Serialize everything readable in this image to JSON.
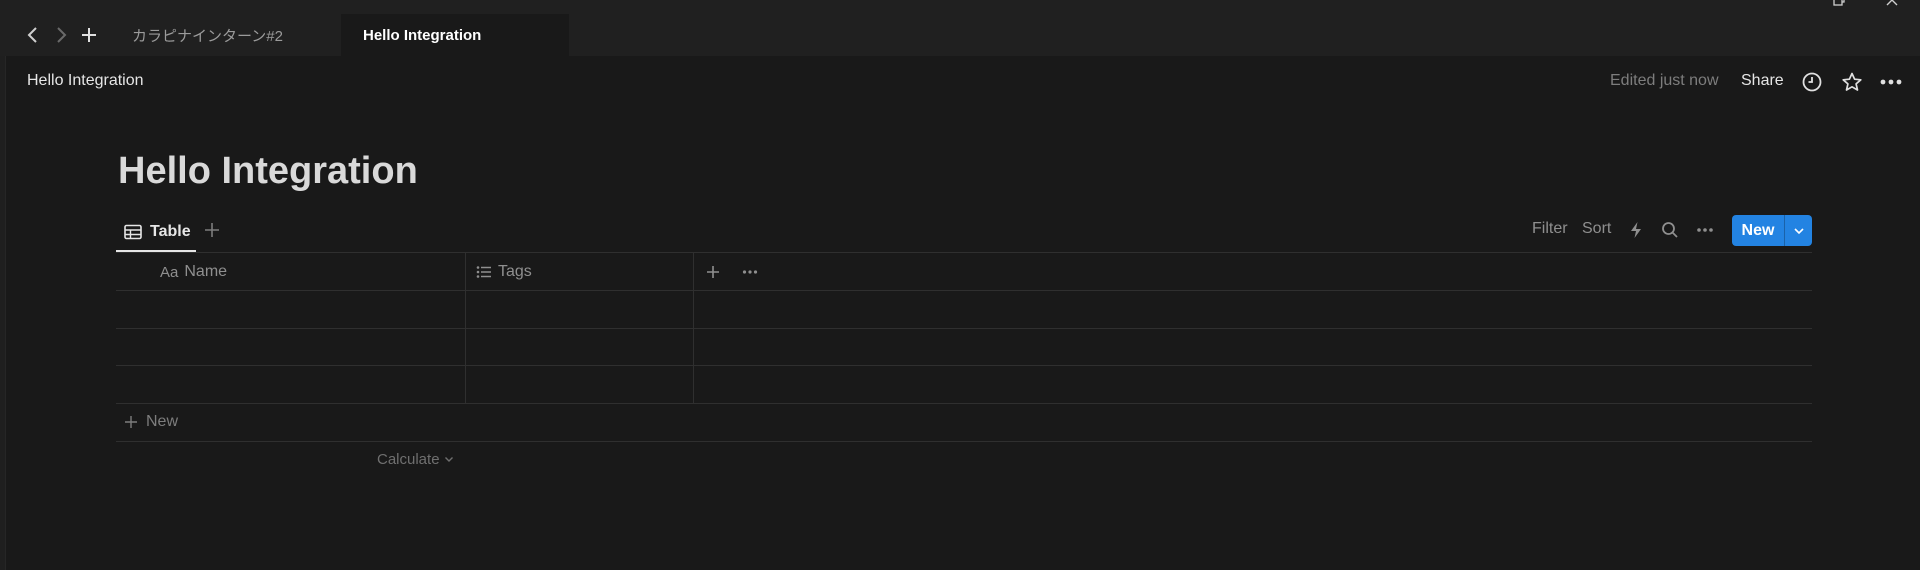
{
  "tabs": [
    {
      "label": "カラピナインターン#2",
      "active": false
    },
    {
      "label": "Hello Integration",
      "active": true
    }
  ],
  "header": {
    "breadcrumb": "Hello Integration",
    "edited": "Edited just now",
    "share_label": "Share",
    "icons": [
      "clock-icon",
      "star-icon",
      "more-icon"
    ]
  },
  "page": {
    "title": "Hello Integration"
  },
  "view": {
    "active_view": "Table",
    "tools": {
      "filter": "Filter",
      "sort": "Sort"
    },
    "new_button": "New",
    "accent_color": "#2383e2"
  },
  "table": {
    "columns": [
      {
        "label": "Name",
        "type_prefix": "Aa"
      },
      {
        "label": "Tags",
        "type_icon": "list-icon"
      }
    ],
    "rows": [
      {
        "name": "",
        "tags": ""
      },
      {
        "name": "",
        "tags": ""
      },
      {
        "name": "",
        "tags": ""
      }
    ],
    "add_row_label": "New",
    "calculate_label": "Calculate"
  }
}
